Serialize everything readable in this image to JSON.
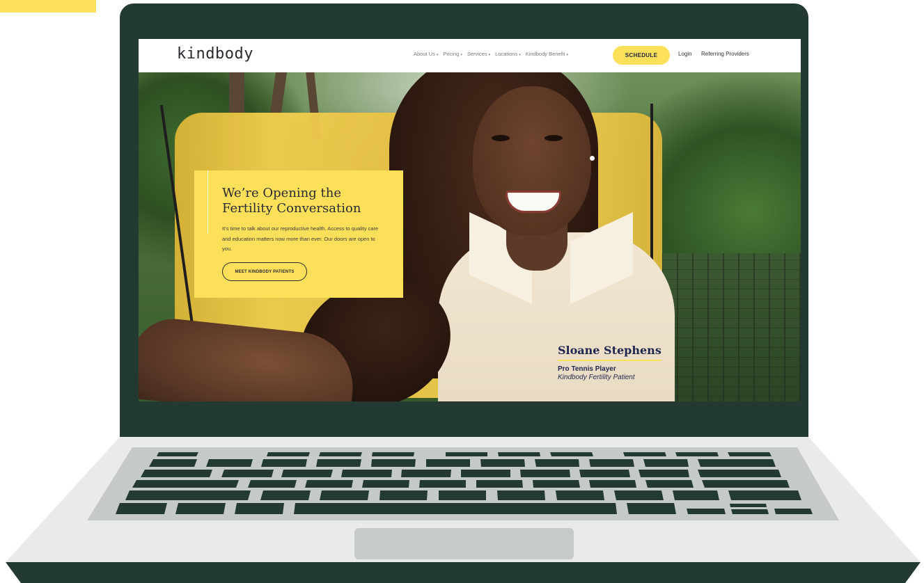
{
  "site": {
    "logo": "kindbody",
    "nav": {
      "items": [
        {
          "label": "About Us"
        },
        {
          "label": "Pricing"
        },
        {
          "label": "Services"
        },
        {
          "label": "Locations"
        },
        {
          "label": "Kindbody Benefit"
        }
      ],
      "caret": "▾",
      "schedule": "SCHEDULE",
      "login": "Login",
      "referring": "Referring Providers"
    },
    "hero": {
      "title": "We’re Opening the Fertility Conversation",
      "body": "It’s time to talk about our reproductive health. Access to quality care and education matters now more than ever. Our doors are open to you.",
      "cta": "MEET KINDBODY PATIENTS",
      "caption": {
        "name": "Sloane Stephens",
        "role": "Pro Tennis Player",
        "subtitle": "Kindbody Fertility Patient"
      }
    }
  },
  "colors": {
    "accent": "#fde05a",
    "laptop": "#233a33",
    "navy": "#1e2650"
  }
}
